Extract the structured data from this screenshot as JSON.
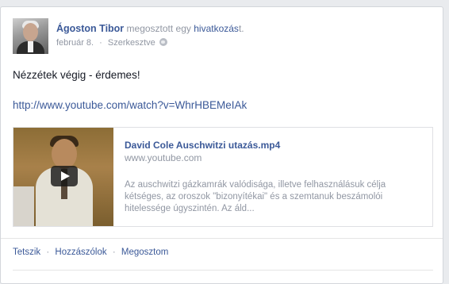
{
  "post": {
    "author": "Ágoston Tibor",
    "action_text": " megosztott egy ",
    "shared_object": "hivatkozás",
    "action_suffix": "t.",
    "date": "február 8.",
    "edited": "Szerkesztve",
    "privacy_icon": "globe-icon",
    "text": "Nézzétek végig - érdemes!",
    "url": "http://www.youtube.com/watch?v=WhrHBEMeIAk"
  },
  "preview": {
    "title": "David Cole Auschwitzi utazás.mp4",
    "domain": "www.youtube.com",
    "description": "Az auschwitzi gázkamrák valódisága, illetve felhasználásuk célja kétséges, az oroszok \"bizonyítékai\" és a szemtanuk beszámolói hitelessége úgyszintén. Az áld...",
    "play_icon": "play-icon"
  },
  "actions": {
    "like": "Tetszik",
    "comment": "Hozzászólok",
    "share": "Megosztom",
    "separator": "·"
  },
  "colors": {
    "link": "#3b5998",
    "muted": "#9197a3",
    "background": "#e9ebee"
  }
}
